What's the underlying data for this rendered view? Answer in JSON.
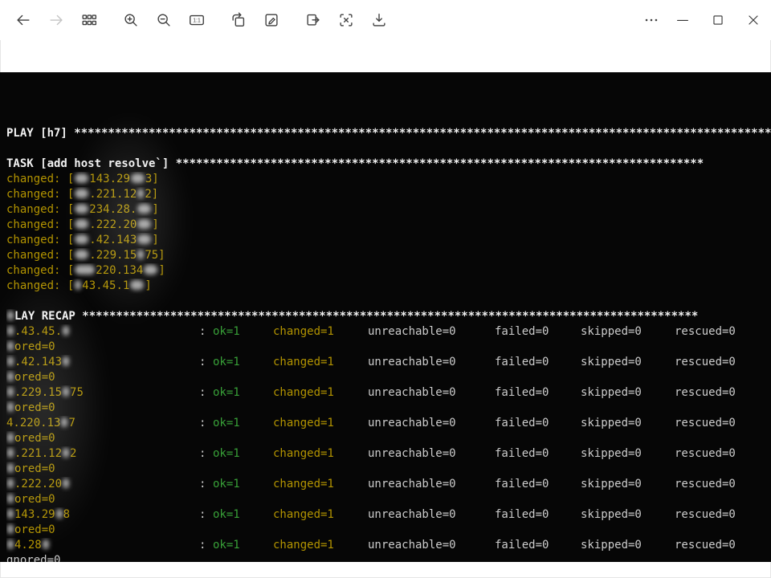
{
  "colors": {
    "terminal_bg": "#060606",
    "terminal_fg": "#cccccc",
    "terminal_header": "#f2f2f2",
    "accent_yellow": "#b39400",
    "ok_green": "#38a038",
    "toolbar_icon": "#3f3f3f",
    "toolbar_icon_disabled": "#c4c4c4"
  },
  "toolbar": {
    "actual_size_label": "1:1",
    "icons": [
      "back",
      "forward",
      "gallery-grid",
      "zoom-in",
      "zoom-out",
      "actual-size",
      "rotate",
      "edit",
      "move-to",
      "text-extract",
      "save"
    ],
    "window_controls": [
      "more-options",
      "minimize",
      "maximize",
      "close"
    ]
  },
  "terminal": {
    "colon": ": ",
    "lines": [
      {
        "kind": "header",
        "segments": [
          {
            "t": "PLAY [h7] *********************************************************************************************************"
          }
        ]
      },
      {
        "kind": "blank"
      },
      {
        "kind": "header",
        "segments": [
          {
            "t": "TASK [add host resolve`] ******************************************************************************"
          }
        ]
      },
      {
        "kind": "changed",
        "segments": [
          {
            "t": "changed: ["
          },
          {
            "r": 2
          },
          {
            "t": "143.29"
          },
          {
            "r": 2
          },
          {
            "t": "3]"
          }
        ]
      },
      {
        "kind": "changed",
        "segments": [
          {
            "t": "changed: ["
          },
          {
            "r": 2
          },
          {
            "t": ".221.12"
          },
          {
            "r": 1
          },
          {
            "t": "2]"
          }
        ]
      },
      {
        "kind": "changed",
        "segments": [
          {
            "t": "changed: ["
          },
          {
            "r": 2
          },
          {
            "t": "234.28."
          },
          {
            "r": 2
          },
          {
            "t": "]"
          }
        ]
      },
      {
        "kind": "changed",
        "segments": [
          {
            "t": "changed: ["
          },
          {
            "r": 2
          },
          {
            "t": ".222.20"
          },
          {
            "r": 2
          },
          {
            "t": "]"
          }
        ]
      },
      {
        "kind": "changed",
        "segments": [
          {
            "t": "changed: ["
          },
          {
            "r": 2
          },
          {
            "t": ".42.143"
          },
          {
            "r": 2
          },
          {
            "t": "]"
          }
        ]
      },
      {
        "kind": "changed",
        "segments": [
          {
            "t": "changed: ["
          },
          {
            "r": 2
          },
          {
            "t": ".229.15"
          },
          {
            "r": 1
          },
          {
            "t": "75]"
          }
        ]
      },
      {
        "kind": "changed",
        "segments": [
          {
            "t": "changed: ["
          },
          {
            "r": 3
          },
          {
            "t": "220.134"
          },
          {
            "r": 2
          },
          {
            "t": "]"
          }
        ]
      },
      {
        "kind": "changed",
        "segments": [
          {
            "t": "changed: ["
          },
          {
            "r": 1
          },
          {
            "t": "43.45.1"
          },
          {
            "r": 2
          },
          {
            "t": "]"
          }
        ]
      },
      {
        "kind": "blank"
      },
      {
        "kind": "header",
        "segments": [
          {
            "r": 1
          },
          {
            "t": "LAY RECAP *******************************************************************************************"
          }
        ]
      },
      {
        "kind": "recap",
        "host": [
          {
            "r": 1
          },
          {
            "t": ".43.45."
          },
          {
            "r": 1
          }
        ],
        "stats": {
          "ok": "ok=1",
          "changed": "changed=1",
          "unreachable": "unreachable=0",
          "failed": "failed=0",
          "skipped": "skipped=0",
          "rescued": "rescued=0"
        }
      },
      {
        "kind": "wrap",
        "color": "yellow",
        "segments": [
          {
            "r": 1
          },
          {
            "t": "ored=0"
          }
        ]
      },
      {
        "kind": "recap",
        "host": [
          {
            "r": 1
          },
          {
            "t": ".42.143"
          },
          {
            "r": 1
          }
        ],
        "stats": {
          "ok": "ok=1",
          "changed": "changed=1",
          "unreachable": "unreachable=0",
          "failed": "failed=0",
          "skipped": "skipped=0",
          "rescued": "rescued=0"
        }
      },
      {
        "kind": "wrap",
        "color": "yellow",
        "segments": [
          {
            "r": 1
          },
          {
            "t": "ored=0"
          }
        ]
      },
      {
        "kind": "recap",
        "host": [
          {
            "r": 1
          },
          {
            "t": ".229.15"
          },
          {
            "r": 1
          },
          {
            "t": "75"
          }
        ],
        "stats": {
          "ok": "ok=1",
          "changed": "changed=1",
          "unreachable": "unreachable=0",
          "failed": "failed=0",
          "skipped": "skipped=0",
          "rescued": "rescued=0"
        }
      },
      {
        "kind": "wrap",
        "color": "yellow",
        "segments": [
          {
            "r": 1
          },
          {
            "t": "ored=0"
          }
        ]
      },
      {
        "kind": "recap",
        "host": [
          {
            "t": "4.220.13"
          },
          {
            "r": 1
          },
          {
            "t": "7"
          }
        ],
        "stats": {
          "ok": "ok=1",
          "changed": "changed=1",
          "unreachable": "unreachable=0",
          "failed": "failed=0",
          "skipped": "skipped=0",
          "rescued": "rescued=0"
        }
      },
      {
        "kind": "wrap",
        "color": "yellow",
        "segments": [
          {
            "r": 1
          },
          {
            "t": "ored=0"
          }
        ]
      },
      {
        "kind": "recap",
        "host": [
          {
            "r": 1
          },
          {
            "t": ".221.12"
          },
          {
            "r": 1
          },
          {
            "t": "2"
          }
        ],
        "stats": {
          "ok": "ok=1",
          "changed": "changed=1",
          "unreachable": "unreachable=0",
          "failed": "failed=0",
          "skipped": "skipped=0",
          "rescued": "rescued=0"
        }
      },
      {
        "kind": "wrap",
        "color": "yellow",
        "segments": [
          {
            "r": 1
          },
          {
            "t": "ored=0"
          }
        ]
      },
      {
        "kind": "recap",
        "host": [
          {
            "r": 1
          },
          {
            "t": ".222.20"
          },
          {
            "r": 1
          }
        ],
        "stats": {
          "ok": "ok=1",
          "changed": "changed=1",
          "unreachable": "unreachable=0",
          "failed": "failed=0",
          "skipped": "skipped=0",
          "rescued": "rescued=0"
        }
      },
      {
        "kind": "wrap",
        "color": "yellow",
        "segments": [
          {
            "r": 1
          },
          {
            "t": "ored=0"
          }
        ]
      },
      {
        "kind": "recap",
        "host": [
          {
            "r": 1
          },
          {
            "t": "143.29"
          },
          {
            "r": 1
          },
          {
            "t": "8"
          }
        ],
        "stats": {
          "ok": "ok=1",
          "changed": "changed=1",
          "unreachable": "unreachable=0",
          "failed": "failed=0",
          "skipped": "skipped=0",
          "rescued": "rescued=0"
        }
      },
      {
        "kind": "wrap",
        "color": "yellow",
        "segments": [
          {
            "r": 1
          },
          {
            "t": "ored=0"
          }
        ]
      },
      {
        "kind": "recap",
        "host": [
          {
            "r": 1
          },
          {
            "t": "4.28"
          },
          {
            "r": 1
          }
        ],
        "stats": {
          "ok": "ok=1",
          "changed": "changed=1",
          "unreachable": "unreachable=0",
          "failed": "failed=0",
          "skipped": "skipped=0",
          "rescued": "rescued=0"
        }
      },
      {
        "kind": "wrap",
        "color": "gray",
        "segments": [
          {
            "t": "gnored=0"
          }
        ]
      }
    ]
  }
}
